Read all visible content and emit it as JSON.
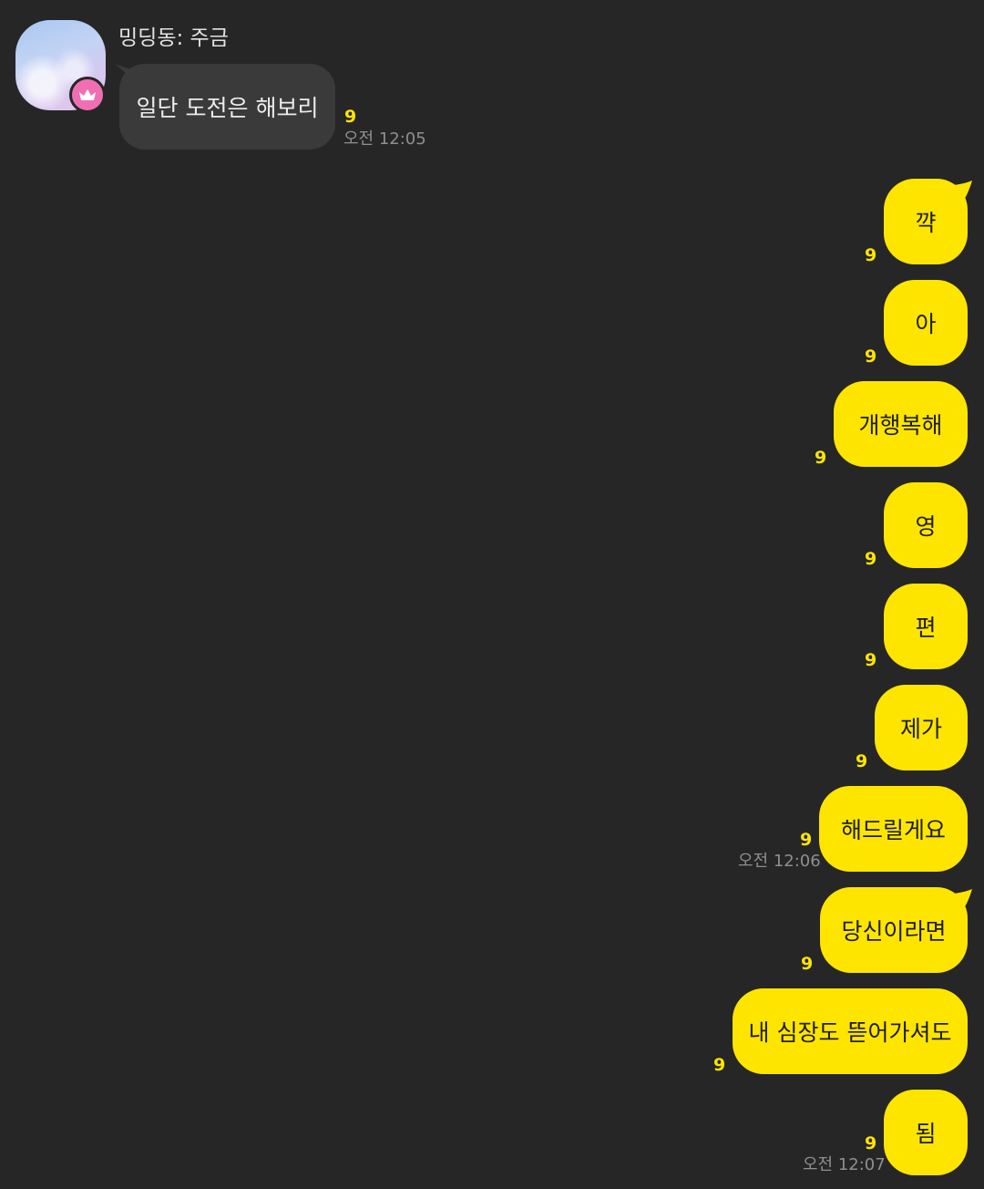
{
  "colors": {
    "background": "#262626",
    "incoming_bubble": "#3a3a3a",
    "outgoing_bubble": "#fee500",
    "unread_count": "#fee500",
    "badge": "#f06fb3"
  },
  "incoming": {
    "sender": "밍딩동: 주금",
    "avatar_icon": "profile-photo-sky-clouds",
    "badge_icon": "crown-icon",
    "message": "일단 도전은 해보리",
    "unread": "9",
    "time": "오전 12:05"
  },
  "outgoing": [
    {
      "text": "꺅",
      "unread": "9"
    },
    {
      "text": "아",
      "unread": "9"
    },
    {
      "text": "개행복해",
      "unread": "9"
    },
    {
      "text": "영",
      "unread": "9"
    },
    {
      "text": "편",
      "unread": "9"
    },
    {
      "text": "제가",
      "unread": "9"
    },
    {
      "text": "해드릴게요",
      "unread": "9",
      "time": "오전 12:06"
    },
    {
      "text": "당신이라면",
      "unread": "9"
    },
    {
      "text": "내 심장도 뜯어가셔도",
      "unread": "9"
    },
    {
      "text": "됨",
      "unread": "9",
      "time": "오전 12:07"
    }
  ]
}
